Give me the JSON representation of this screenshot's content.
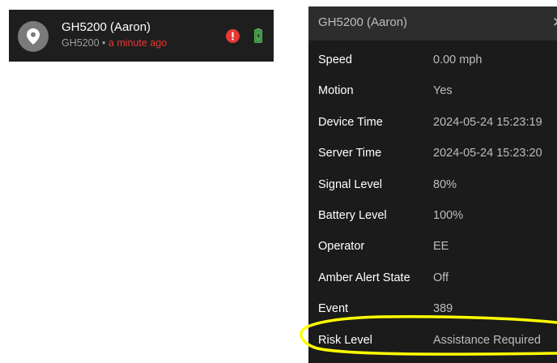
{
  "device_item": {
    "title": "GH5200 (Aaron)",
    "subtitle_id": "GH5200",
    "subtitle_separator": " • ",
    "subtitle_time": "a minute ago",
    "avatar_icon": "location-pin-icon",
    "status_icons": [
      "alert-icon",
      "battery-charging-icon"
    ]
  },
  "popup": {
    "title": "GH5200 (Aaron)",
    "close_label": "✕",
    "rows": [
      {
        "key": "Speed",
        "value": "0.00 mph"
      },
      {
        "key": "Motion",
        "value": "Yes"
      },
      {
        "key": "Device Time",
        "value": "2024-05-24 15:23:19"
      },
      {
        "key": "Server Time",
        "value": "2024-05-24 15:23:20"
      },
      {
        "key": "Signal Level",
        "value": "80%"
      },
      {
        "key": "Battery Level",
        "value": "100%"
      },
      {
        "key": "Operator",
        "value": "EE"
      },
      {
        "key": "Amber Alert State",
        "value": "Off"
      },
      {
        "key": "Event",
        "value": "389"
      },
      {
        "key": "Risk Level",
        "value": "Assistance Required"
      }
    ]
  },
  "colors": {
    "item_background": "#1e1e1e",
    "popup_background": "#1b1b1b",
    "popup_header_background": "#2d2d2d",
    "time_red": "#e53935",
    "alert_red": "#e53935",
    "battery_green": "#4caf50",
    "highlight_yellow": "#ffff00"
  }
}
